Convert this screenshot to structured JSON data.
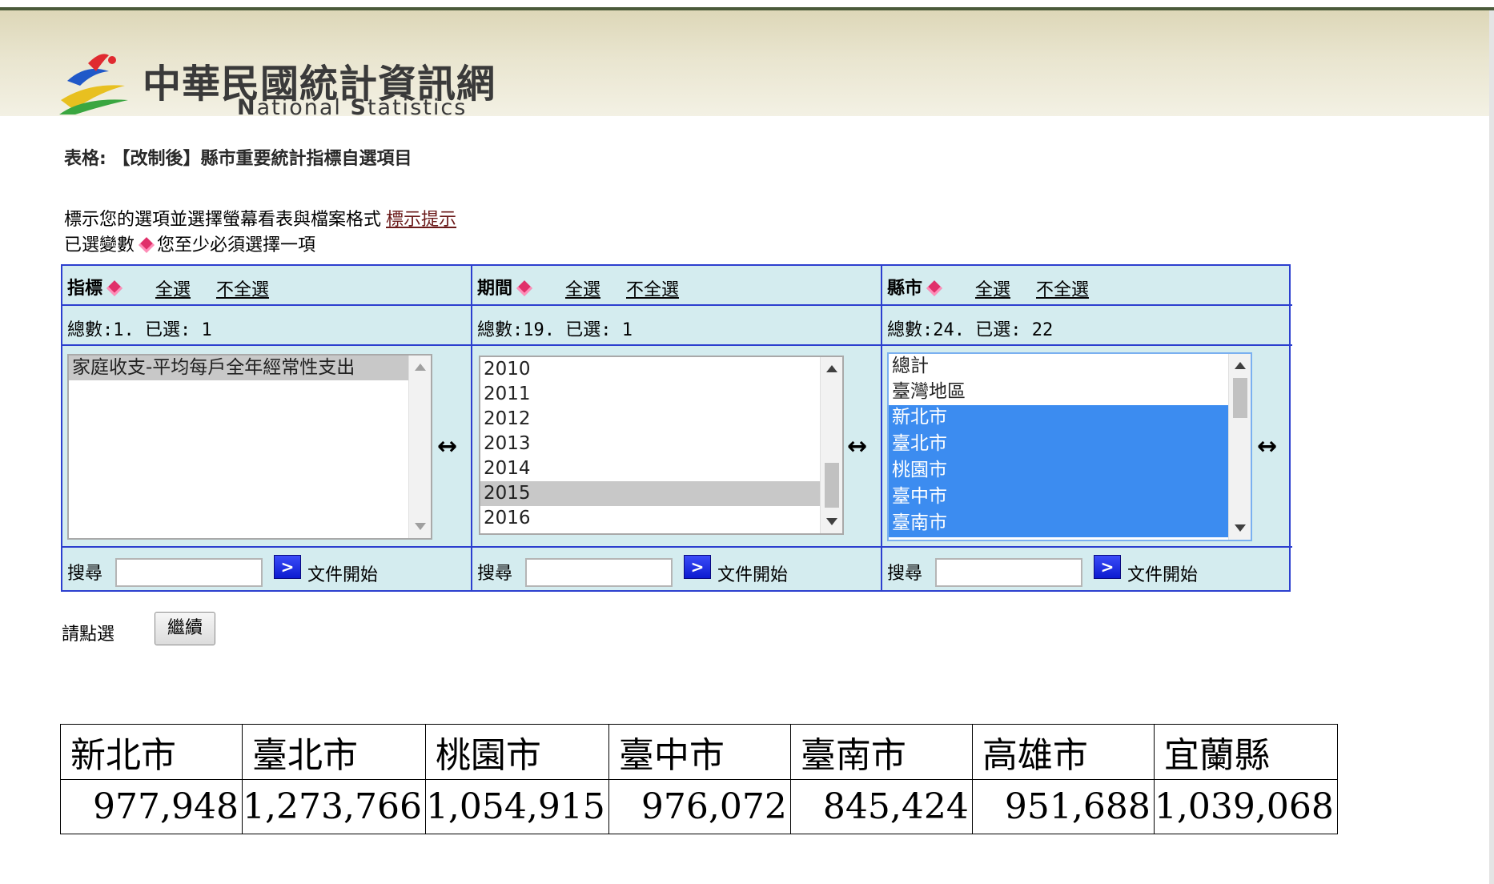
{
  "header": {
    "title_zh": "中華民國統計資訊網",
    "title_en_parts": [
      "N",
      "ational ",
      "S",
      "tatistics"
    ]
  },
  "page": {
    "table_title": "表格: 【改制後】縣市重要統計指標自選項目",
    "instruction": "標示您的選項並選擇螢幕看表與檔案格式",
    "hint_link": "標示提示",
    "selected_vars_label": "已選變數",
    "required_note": "您至少必須選擇一項"
  },
  "columns": [
    {
      "label": "指標",
      "select_all": "全選",
      "deselect_all": "不全選",
      "count_text": "總數:1. 已選: 1",
      "items": [
        "家庭收支-平均每戶全年經常性支出"
      ],
      "search_label": "搜尋",
      "search_button": ">",
      "doc_start": "文件開始"
    },
    {
      "label": "期間",
      "select_all": "全選",
      "deselect_all": "不全選",
      "count_text": "總數:19. 已選: 1",
      "items": [
        "2010",
        "2011",
        "2012",
        "2013",
        "2014",
        "2015",
        "2016"
      ],
      "search_label": "搜尋",
      "search_button": ">",
      "doc_start": "文件開始"
    },
    {
      "label": "縣市",
      "select_all": "全選",
      "deselect_all": "不全選",
      "count_text": "總數:24. 已選: 22",
      "items": [
        "總計",
        "臺灣地區",
        "新北市",
        "臺北市",
        "桃園市",
        "臺中市",
        "臺南市"
      ],
      "search_label": "搜尋",
      "search_button": ">",
      "doc_start": "文件開始"
    }
  ],
  "swap_icon": "↔",
  "continue": {
    "label": "請點選",
    "button": "繼續"
  },
  "result_table": {
    "headers": [
      "新北市",
      "臺北市",
      "桃園市",
      "臺中市",
      "臺南市",
      "高雄市",
      "宜蘭縣"
    ],
    "values": [
      "977,948",
      "1,273,766",
      "1,054,915",
      "976,072",
      "845,424",
      "951,688",
      "1,039,068"
    ]
  }
}
